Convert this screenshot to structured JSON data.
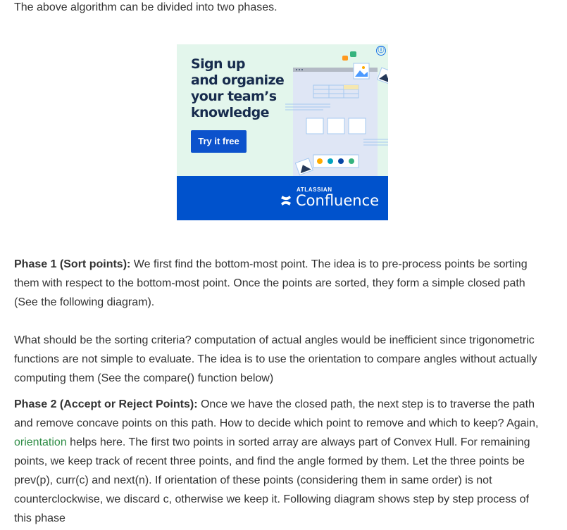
{
  "intro": "The above algorithm can be divided into two phases.",
  "ad": {
    "headline_lines": [
      "Sign up",
      "and organize",
      "your team’s",
      "knowledge"
    ],
    "cta_label": "Try it free",
    "brand_small": "ATLASSIAN",
    "brand": "Confluence",
    "info_icon": "ⓘ",
    "colors": {
      "bg": "#e3f6ec",
      "button": "#0c52cc",
      "footer": "#0052cc"
    }
  },
  "phase1": {
    "heading": "Phase 1 (Sort points):",
    "body": " We first find the bottom-most point. The idea is to pre-process points be sorting them with respect to the bottom-most point. Once the points are sorted, they form a simple closed path (See the following diagram)."
  },
  "criteria": "What should be the sorting criteria? computation of actual angles would be inefficient since trigonometric functions are not simple to evaluate. The idea is to use the orientation to compare angles without actually computing them (See the compare() function below)",
  "phase2": {
    "heading": "Phase 2 (Accept or Reject Points):",
    "body_before": " Once we have the closed path, the next step is to traverse the path and remove concave points on this path. How to decide which point to remove and which to keep? Again, ",
    "link": "orientation",
    "body_after": " helps here. The first two points in sorted array are always part of Convex Hull. For remaining points, we keep track of recent three points, and find the angle formed by them. Let the three points be prev(p), curr(c) and next(n). If orientation of these points (considering them in same order) is not counterclockwise, we discard c, otherwise we keep it. Following diagram shows step by step process of this phase"
  },
  "colors": {
    "text": "#333333",
    "link": "#2f8d46"
  }
}
